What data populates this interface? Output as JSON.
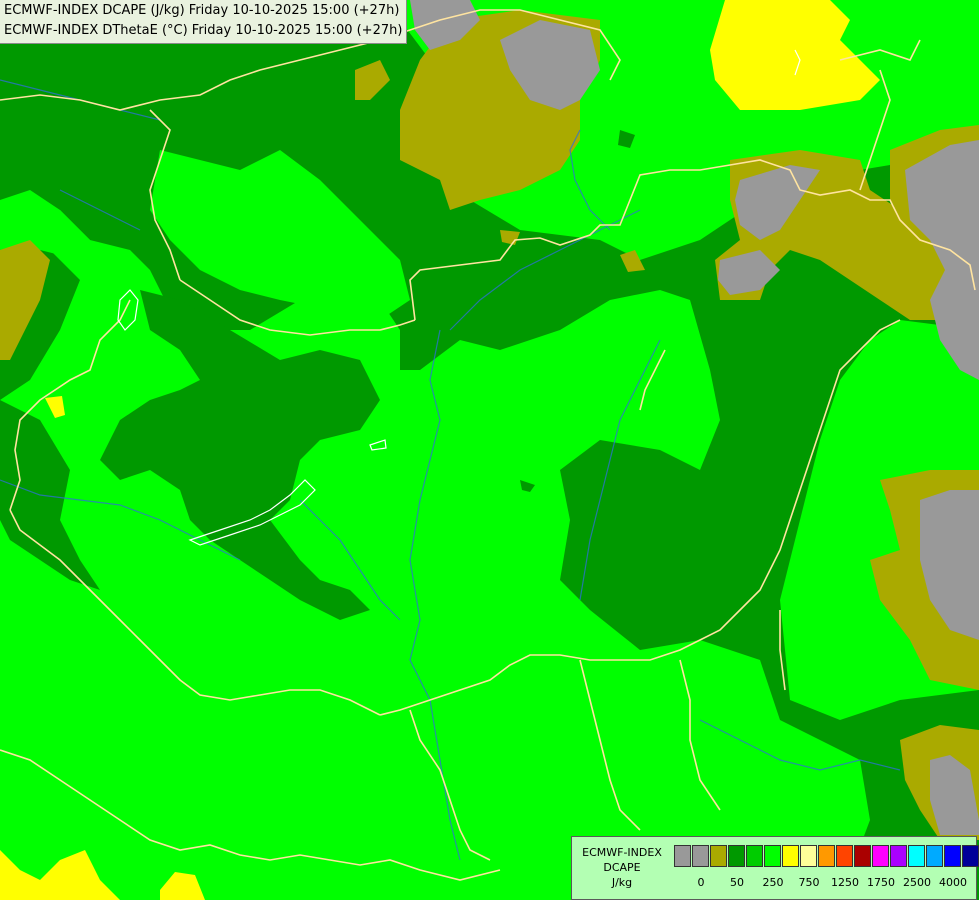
{
  "header": {
    "line1": "ECMWF-INDEX DCAPE (J/kg) Friday 10-10-2025 15:00 (+27h)",
    "line2": "ECMWF-INDEX DThetaE (°C) Friday 10-10-2025 15:00 (+27h)"
  },
  "legend": {
    "line1": "ECMWF-INDEX",
    "line2": "DCAPE",
    "line3": "J/kg",
    "colors": [
      "#999999",
      "#999999",
      "#aaaa00",
      "#009900",
      "#00cc00",
      "#00ff00",
      "#ffff00",
      "#ffff99",
      "#ff9900",
      "#ff4400",
      "#aa0000",
      "#ff00ff",
      "#aa00ff",
      "#00ffff",
      "#00aaff",
      "#0000ff",
      "#000099"
    ],
    "ticks": [
      "0",
      "50",
      "250",
      "750",
      "1250",
      "1750",
      "2500",
      "4000"
    ]
  },
  "map_colors": {
    "base": "#00ff00",
    "dark_green": "#009900",
    "olive": "#aaaa00",
    "gray": "#999999",
    "yellow": "#ffff00",
    "border": "#ffe4a0",
    "river": "#2f6fd8"
  }
}
